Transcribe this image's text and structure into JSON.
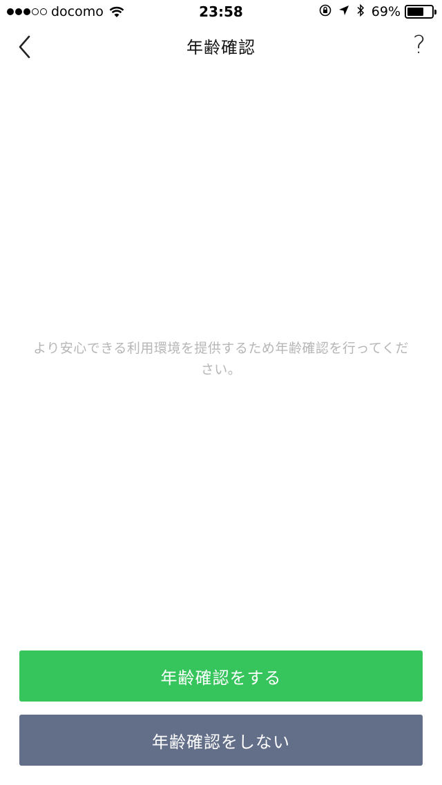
{
  "status_bar": {
    "carrier": "docomo",
    "signal_strength": 3,
    "signal_max": 5,
    "time": "23:58",
    "battery_percent": "69%",
    "battery_level": 0.69,
    "icons": [
      "wifi-icon",
      "rotation-lock-icon",
      "location-arrow-icon",
      "bluetooth-icon",
      "battery-icon"
    ]
  },
  "nav": {
    "title": "年齢確認",
    "back_icon": "chevron-left-icon",
    "help_label": "?"
  },
  "main": {
    "message": "より安心できる利用環境を提供するため年齢確認を行ってください。"
  },
  "actions": {
    "verify_label": "年齢確認をする",
    "skip_label": "年齢確認をしない"
  },
  "colors": {
    "verify_button": "#36c45c",
    "skip_button": "#636f89",
    "message_text": "#b6b6b6"
  }
}
